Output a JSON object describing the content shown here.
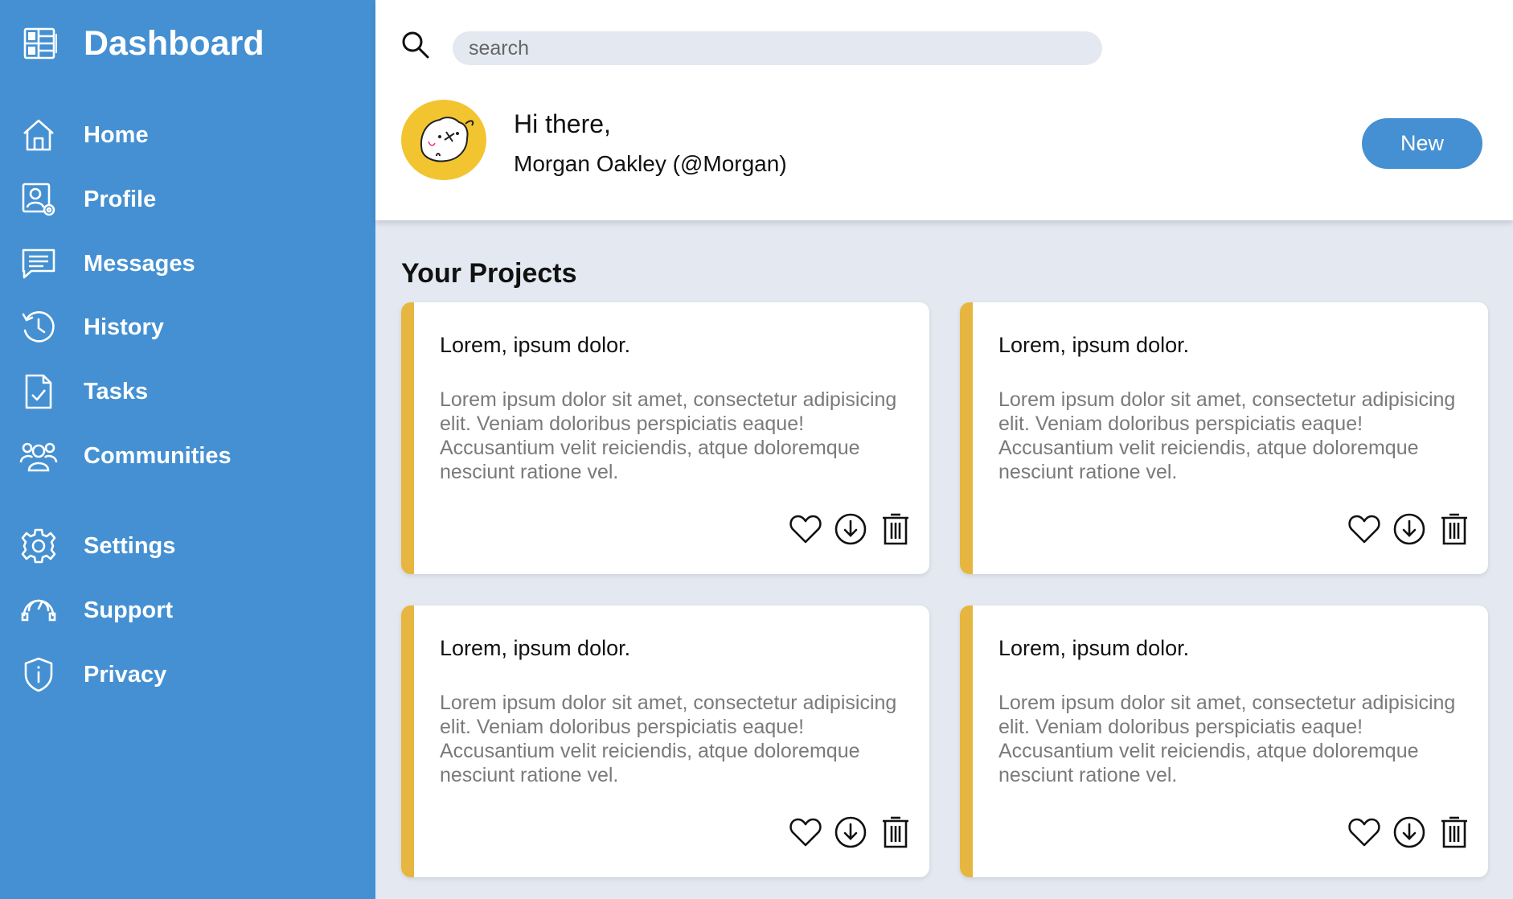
{
  "app": {
    "title": "Dashboard"
  },
  "sidebar": {
    "items": [
      {
        "label": "Home"
      },
      {
        "label": "Profile"
      },
      {
        "label": "Messages"
      },
      {
        "label": "History"
      },
      {
        "label": "Tasks"
      },
      {
        "label": "Communities"
      },
      {
        "label": "Settings"
      },
      {
        "label": "Support"
      },
      {
        "label": "Privacy"
      }
    ]
  },
  "header": {
    "search_placeholder": "search",
    "greeting": "Hi there,",
    "user": "Morgan Oakley (@Morgan)",
    "new_label": "New"
  },
  "main": {
    "section_title": "Your Projects",
    "cards": [
      {
        "title": "Lorem, ipsum dolor.",
        "body": "Lorem ipsum dolor sit amet, consectetur adipisicing elit. Veniam doloribus perspiciatis eaque! Accusantium velit reiciendis, atque doloremque nesciunt ratione vel."
      },
      {
        "title": "Lorem, ipsum dolor.",
        "body": "Lorem ipsum dolor sit amet, consectetur adipisicing elit. Veniam doloribus perspiciatis eaque! Accusantium velit reiciendis, atque doloremque nesciunt ratione vel."
      },
      {
        "title": "Lorem, ipsum dolor.",
        "body": "Lorem ipsum dolor sit amet, consectetur adipisicing elit. Veniam doloribus perspiciatis eaque! Accusantium velit reiciendis, atque doloremque nesciunt ratione vel."
      },
      {
        "title": "Lorem, ipsum dolor.",
        "body": "Lorem ipsum dolor sit amet, consectetur adipisicing elit. Veniam doloribus perspiciatis eaque! Accusantium velit reiciendis, atque doloremque nesciunt ratione vel."
      }
    ]
  },
  "colors": {
    "sidebar": "#4490d2",
    "accent": "#e6b640",
    "background": "#e3e8f1",
    "avatar_bg": "#f2c530"
  },
  "icons": {
    "brand": "dashboard-icon",
    "nav": [
      "home-icon",
      "profile-icon",
      "messages-icon",
      "history-icon",
      "tasks-icon",
      "communities-icon",
      "settings-icon",
      "support-icon",
      "privacy-icon"
    ],
    "card_actions": [
      "heart-icon",
      "download-icon",
      "trash-icon"
    ]
  }
}
